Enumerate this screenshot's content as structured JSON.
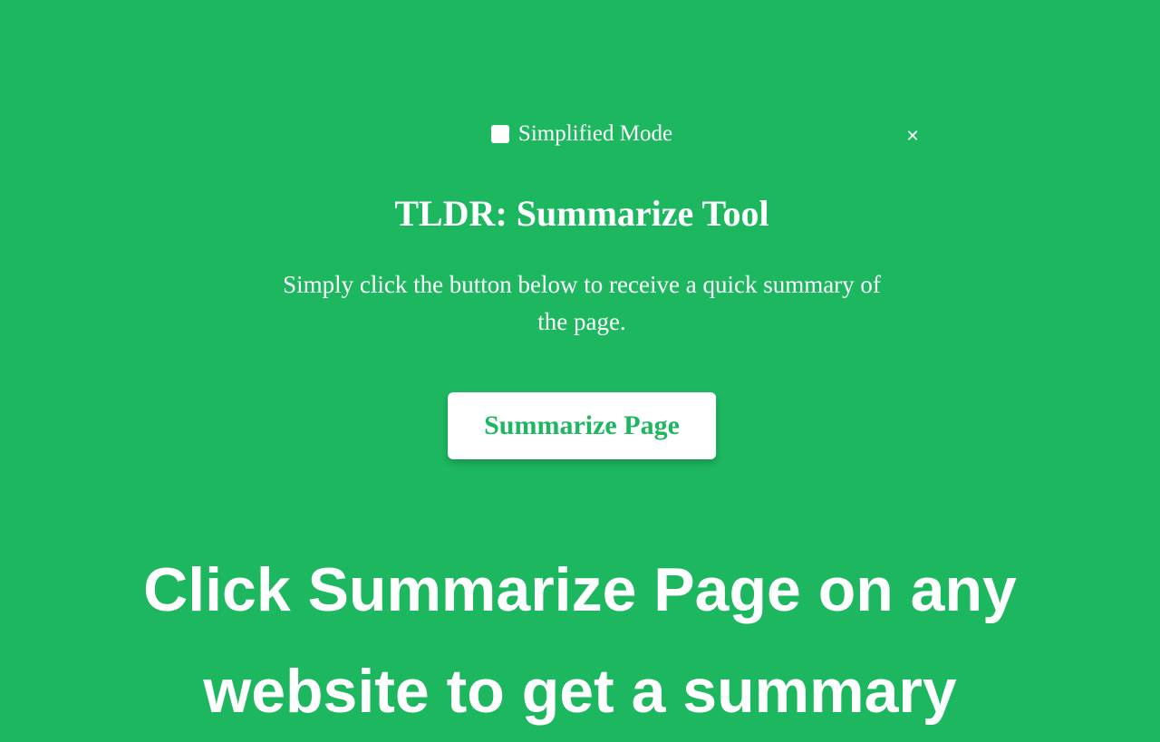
{
  "panel": {
    "mode_label": "Simplified Mode",
    "title": "TLDR: Summarize Tool",
    "description": "Simply click the button below to receive a quick summary of the page.",
    "button_label": "Summarize Page",
    "close_icon": "✕"
  },
  "caption": "Click Summarize Page on any website to get a summary",
  "colors": {
    "background": "#1db760",
    "button_text": "#1db760",
    "text": "#ffffff"
  }
}
